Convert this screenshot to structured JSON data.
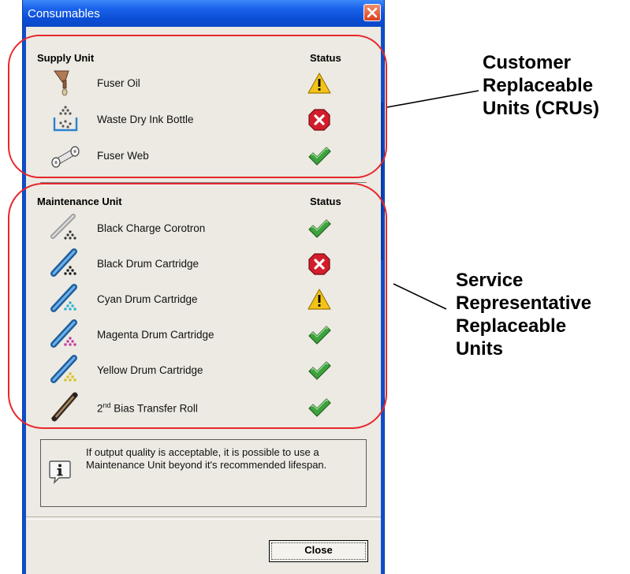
{
  "window": {
    "title": "Consumables",
    "close_icon": "close-x-icon"
  },
  "supply": {
    "header": "Supply Unit",
    "status_header": "Status",
    "items": [
      {
        "label": "Fuser Oil",
        "icon": "fuser-oil-icon",
        "status": "warning"
      },
      {
        "label": "Waste Dry Ink Bottle",
        "icon": "waste-bottle-icon",
        "status": "error"
      },
      {
        "label": "Fuser Web",
        "icon": "fuser-web-icon",
        "status": "ok"
      }
    ]
  },
  "maintenance": {
    "header": "Maintenance Unit",
    "status_header": "Status",
    "items": [
      {
        "label": "Black Charge Corotron",
        "icon": "corotron-icon",
        "status": "ok"
      },
      {
        "label": "Black Drum Cartridge",
        "icon": "drum-cartridge-icon",
        "status": "error",
        "color": "#222222"
      },
      {
        "label": "Cyan Drum Cartridge",
        "icon": "drum-cartridge-icon",
        "status": "warning",
        "color": "#2bb3d6"
      },
      {
        "label": "Magenta Drum Cartridge",
        "icon": "drum-cartridge-icon",
        "status": "ok",
        "color": "#c63aa0"
      },
      {
        "label": "Yellow Drum Cartridge",
        "icon": "drum-cartridge-icon",
        "status": "ok",
        "color": "#d9c21c"
      },
      {
        "label_sup": "nd",
        "label_pre": "2",
        "label_post": " Bias Transfer Roll",
        "icon": "transfer-roll-icon",
        "status": "ok"
      }
    ]
  },
  "info": {
    "icon": "info-icon",
    "text": "If output quality is acceptable, it is possible to use a Maintenance Unit beyond it's recommended lifespan."
  },
  "buttons": {
    "close_label": "Close"
  },
  "annotations": {
    "cru": [
      "Customer",
      "Replaceable",
      "Units (CRUs)"
    ],
    "srru": [
      "Service",
      "Representative",
      "Replaceable",
      "Units"
    ],
    "oval_color": "#e8262c"
  },
  "colors": {
    "title_bar": "#0b4ed6",
    "dialog_bg": "#eceae2",
    "status_ok": "#3da33d",
    "status_error": "#d21d2b",
    "status_warning": "#f2c318"
  }
}
